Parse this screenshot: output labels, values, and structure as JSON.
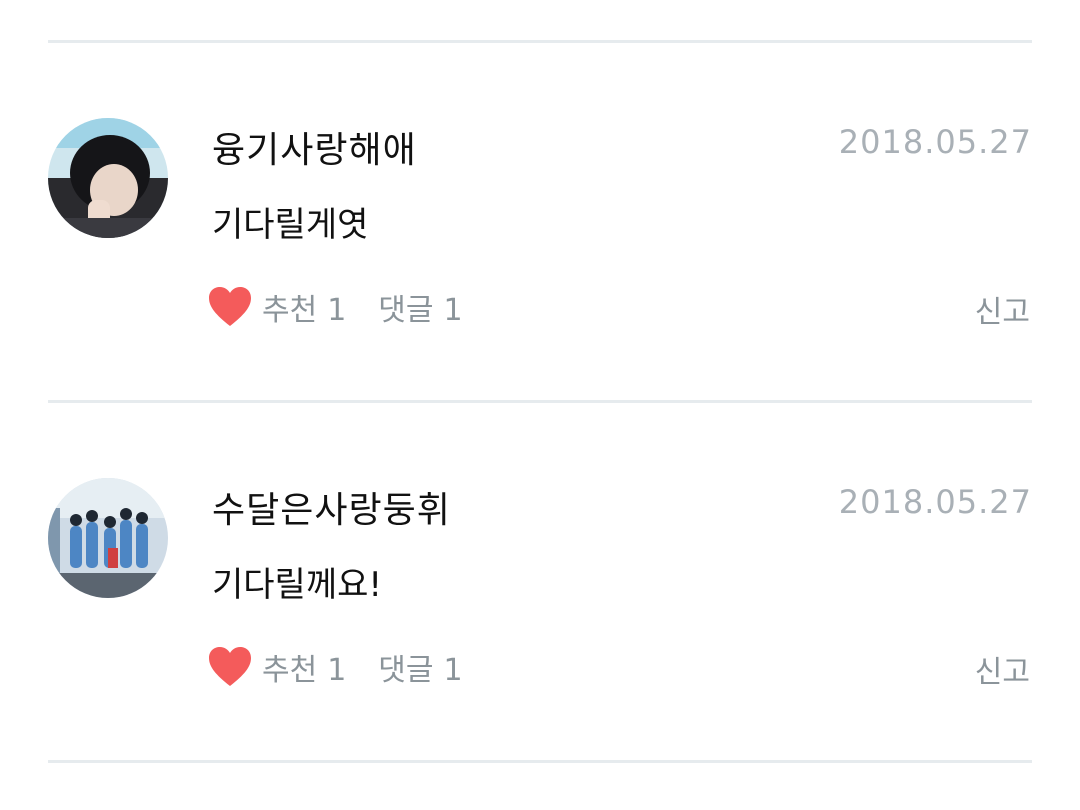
{
  "comments": [
    {
      "username": "융기사랑해애",
      "date": "2018.05.27",
      "text": "기다릴게엿",
      "likes_label": "추천",
      "likes_count": "1",
      "replies_label": "댓글",
      "replies_count": "1",
      "report_label": "신고"
    },
    {
      "username": "수달은사랑둥휘",
      "date": "2018.05.27",
      "text": "기다릴께요!",
      "likes_label": "추천",
      "likes_count": "1",
      "replies_label": "댓글",
      "replies_count": "1",
      "report_label": "신고"
    }
  ],
  "colors": {
    "heart": "#f45b5b",
    "divider": "#e6ebee",
    "muted_text": "#8b949a",
    "date_text": "#a9b0b6"
  },
  "icons": {
    "like": "heart-icon"
  }
}
